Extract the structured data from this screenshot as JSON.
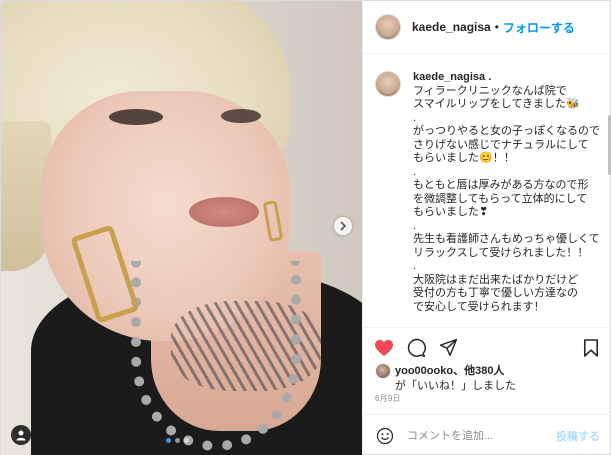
{
  "post": {
    "username": "kaede_nagisa",
    "follow_label": "フォローする",
    "separator": "•",
    "caption_username": "kaede_nagisa",
    "caption_username_suffix": ".",
    "caption_lines": [
      "フィラークリニックなんば院で",
      "スマイルリップをしてきました🐝",
      ".",
      "がっつりやると女の子っぽくなるので",
      "さりげない感じでナチュラルにして",
      "もらいました😊！！",
      ".",
      "もともと唇は厚みがある方なので形",
      "を微調整してもらって立体的にして",
      "もらいました❣",
      ".",
      "先生も看護師さんもめっちゃ優しくて",
      "リラックスして受けられました！！",
      ".",
      "大阪院はまだ出来たばかりだけど",
      "受付の方も丁寧で優しい方達なの",
      "で安心して受けられます！"
    ],
    "likes_user": "yoo00ooko",
    "likes_others": "、他380人",
    "likes_line2": "が「いいね！」しました",
    "date": "6月9日",
    "comment_placeholder": "コメントを追加...",
    "post_button": "投稿する",
    "carousel_count": 3,
    "carousel_active": 0
  },
  "icons": {
    "like": "heart-filled-icon",
    "comment": "comment-bubble-icon",
    "share": "paper-plane-icon",
    "save": "bookmark-icon",
    "emoji": "smiley-icon",
    "tag": "user-tag-icon",
    "next": "chevron-right-icon"
  },
  "colors": {
    "like": "#ed4956",
    "follow": "#0095f6",
    "post_button_disabled": "#b2dffc",
    "carousel_active": "#3897f0"
  }
}
